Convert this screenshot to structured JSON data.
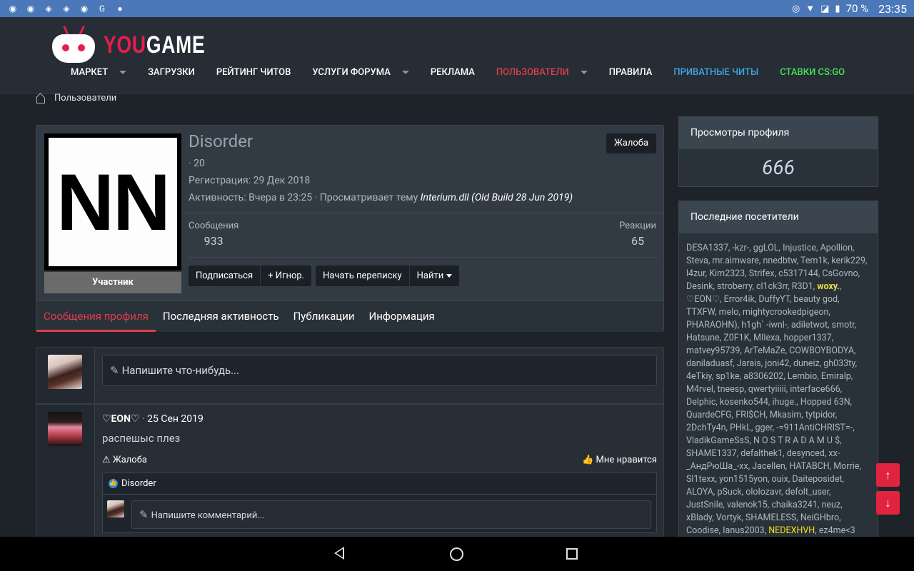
{
  "status_bar": {
    "left_icons": [
      "rss-icon",
      "rss-icon",
      "discord-icon",
      "discord-icon",
      "rss-icon",
      "g-icon",
      "chat-icon"
    ],
    "battery": "70 %",
    "time": "23:35"
  },
  "header": {
    "logo_you": "YOU",
    "logo_game": "GAME",
    "nav": [
      {
        "label": "МАРКЕТ",
        "caret": true,
        "color": "#ffffff"
      },
      {
        "label": "ЗАГРУЗКИ",
        "caret": false,
        "color": "#ffffff"
      },
      {
        "label": "РЕЙТИНГ ЧИТОВ",
        "caret": false,
        "color": "#ffffff"
      },
      {
        "label": "УСЛУГИ ФОРУМА",
        "caret": true,
        "color": "#ffffff"
      },
      {
        "label": "РЕКЛАМА",
        "caret": false,
        "color": "#ffffff"
      },
      {
        "label": "ПОЛЬЗОВАТЕЛИ",
        "caret": true,
        "color": "#e03c4e"
      },
      {
        "label": "ПРАВИЛА",
        "caret": false,
        "color": "#ffffff"
      },
      {
        "label": "ПРИВАТНЫЕ ЧИТЫ",
        "caret": false,
        "color": "#3ea8e5"
      },
      {
        "label": "СТАВКИ CS:GO",
        "caret": false,
        "color": "#4ce05a"
      }
    ]
  },
  "breadcrumb": {
    "label": "Пользователи"
  },
  "profile": {
    "avatar_text": "NN",
    "role": "Участник",
    "username": "Disorder",
    "complaint": "Жалоба",
    "points": "· 20",
    "registration": "Регистрация: 29 Дек 2018",
    "activity_prefix": "Активность: Вчера в 23:25 · Просматривает тему",
    "activity_topic": "Interium.dll (Old Build 28 Jun 2019)",
    "messages_label": "Сообщения",
    "messages_value": "933",
    "reactions_label": "Реакции",
    "reactions_value": "65",
    "buttons": {
      "subscribe": "Подписаться",
      "ignore": "+ Игнор.",
      "start_conversation": "Начать переписку",
      "find": "Найти"
    },
    "tabs": [
      "Сообщения профиля",
      "Последняя активность",
      "Публикации",
      "Информация"
    ],
    "active_tab": 0
  },
  "posts": {
    "write_placeholder": "Напишите что-нибудь...",
    "post": {
      "author": "♡EON♡",
      "date": "25 Сен 2019",
      "body": "распешыс плез",
      "report": "Жалоба",
      "like": "Мне нравится",
      "liked_by": "Disorder",
      "comment_placeholder": "Напишите комментарий..."
    }
  },
  "sidebar": {
    "views_title": "Просмотры профиля",
    "views_value": "666",
    "visitors_title": "Последние посетители",
    "visitors": [
      {
        "name": "DESA1337",
        "style": ""
      },
      {
        "name": "-kzr-",
        "style": ""
      },
      {
        "name": "ggLOL",
        "style": ""
      },
      {
        "name": "Injustice",
        "style": ""
      },
      {
        "name": "Apollion",
        "style": ""
      },
      {
        "name": "Steva",
        "style": ""
      },
      {
        "name": "mr.aimware",
        "style": ""
      },
      {
        "name": "nnedbtw",
        "style": ""
      },
      {
        "name": "Tem1k",
        "style": ""
      },
      {
        "name": "kerik229",
        "style": ""
      },
      {
        "name": "l4zur",
        "style": ""
      },
      {
        "name": "Kim2323",
        "style": ""
      },
      {
        "name": "Strifex",
        "style": ""
      },
      {
        "name": "c5317144",
        "style": ""
      },
      {
        "name": "CsGovno",
        "style": ""
      },
      {
        "name": "Desink",
        "style": ""
      },
      {
        "name": "stroberry",
        "style": ""
      },
      {
        "name": "cl1ck3rr",
        "style": ""
      },
      {
        "name": "R3D1",
        "style": ""
      },
      {
        "name": "woxy.",
        "style": "yl"
      },
      {
        "name": "♡EON♡",
        "style": ""
      },
      {
        "name": "Error4ik",
        "style": ""
      },
      {
        "name": "DuffyYT",
        "style": ""
      },
      {
        "name": "beauty god",
        "style": ""
      },
      {
        "name": "TTXFW",
        "style": ""
      },
      {
        "name": "melo",
        "style": ""
      },
      {
        "name": "mightycrookedpigeon",
        "style": ""
      },
      {
        "name": "PHARAOHN)",
        "style": ""
      },
      {
        "name": "h1gh` -iwnl-",
        "style": ""
      },
      {
        "name": "adiletwot",
        "style": ""
      },
      {
        "name": "smotr",
        "style": ""
      },
      {
        "name": "Hatsune",
        "style": ""
      },
      {
        "name": "Z0F1K",
        "style": ""
      },
      {
        "name": "MIlexa",
        "style": ""
      },
      {
        "name": "hopper1337",
        "style": ""
      },
      {
        "name": "matvey95739",
        "style": ""
      },
      {
        "name": "ArTeMaZe",
        "style": ""
      },
      {
        "name": "COWBOYBODYA",
        "style": ""
      },
      {
        "name": "daniladuasf",
        "style": ""
      },
      {
        "name": "Jarais",
        "style": ""
      },
      {
        "name": "joni42",
        "style": ""
      },
      {
        "name": "duneiz",
        "style": ""
      },
      {
        "name": "gh033ty",
        "style": ""
      },
      {
        "name": "4eTkiy",
        "style": ""
      },
      {
        "name": "sp1ke",
        "style": ""
      },
      {
        "name": "a8306202",
        "style": ""
      },
      {
        "name": "Lembio",
        "style": ""
      },
      {
        "name": "Emiralp",
        "style": ""
      },
      {
        "name": "M4rvel",
        "style": ""
      },
      {
        "name": "tneesp",
        "style": ""
      },
      {
        "name": "qwertyiiiii",
        "style": ""
      },
      {
        "name": "interface666",
        "style": ""
      },
      {
        "name": "Delphic",
        "style": ""
      },
      {
        "name": "kosenko544",
        "style": ""
      },
      {
        "name": "ihuge.",
        "style": ""
      },
      {
        "name": "Hopped 63N",
        "style": ""
      },
      {
        "name": "QuardeCFG",
        "style": ""
      },
      {
        "name": "FRI$CH",
        "style": ""
      },
      {
        "name": "Mkasim",
        "style": ""
      },
      {
        "name": "tytpidor",
        "style": ""
      },
      {
        "name": "2DchTy4n",
        "style": ""
      },
      {
        "name": "PHkL",
        "style": ""
      },
      {
        "name": "gger",
        "style": ""
      },
      {
        "name": "-=911AntiCHRIST=-",
        "style": ""
      },
      {
        "name": "VladikGameSsS",
        "style": ""
      },
      {
        "name": "N O S T R A D A M U $",
        "style": ""
      },
      {
        "name": "SHAME1337",
        "style": ""
      },
      {
        "name": "defalthek1",
        "style": ""
      },
      {
        "name": "desynced",
        "style": ""
      },
      {
        "name": "xx-_АндРюШа_-xx",
        "style": ""
      },
      {
        "name": "Jacellen",
        "style": ""
      },
      {
        "name": "HATABCH",
        "style": ""
      },
      {
        "name": "Morrie",
        "style": ""
      },
      {
        "name": "Sl1texx",
        "style": ""
      },
      {
        "name": "yon1515yon",
        "style": ""
      },
      {
        "name": "ouix",
        "style": ""
      },
      {
        "name": "Daiteposidet",
        "style": ""
      },
      {
        "name": "ALOYA",
        "style": ""
      },
      {
        "name": "pSuck",
        "style": ""
      },
      {
        "name": "ololozavr",
        "style": ""
      },
      {
        "name": "defolt_user",
        "style": ""
      },
      {
        "name": "JustSnile",
        "style": ""
      },
      {
        "name": "valenok15",
        "style": ""
      },
      {
        "name": "chaika3241",
        "style": ""
      },
      {
        "name": "neuz",
        "style": ""
      },
      {
        "name": "xBlady",
        "style": ""
      },
      {
        "name": "Vortyk",
        "style": ""
      },
      {
        "name": "SHAMELESS",
        "style": ""
      },
      {
        "name": "NeiGHbro",
        "style": ""
      },
      {
        "name": "Coodise",
        "style": ""
      },
      {
        "name": "Ianus2003",
        "style": ""
      },
      {
        "name": "NEDEXHVH",
        "style": "yl2"
      },
      {
        "name": "ez4me<3",
        "style": ""
      }
    ]
  }
}
